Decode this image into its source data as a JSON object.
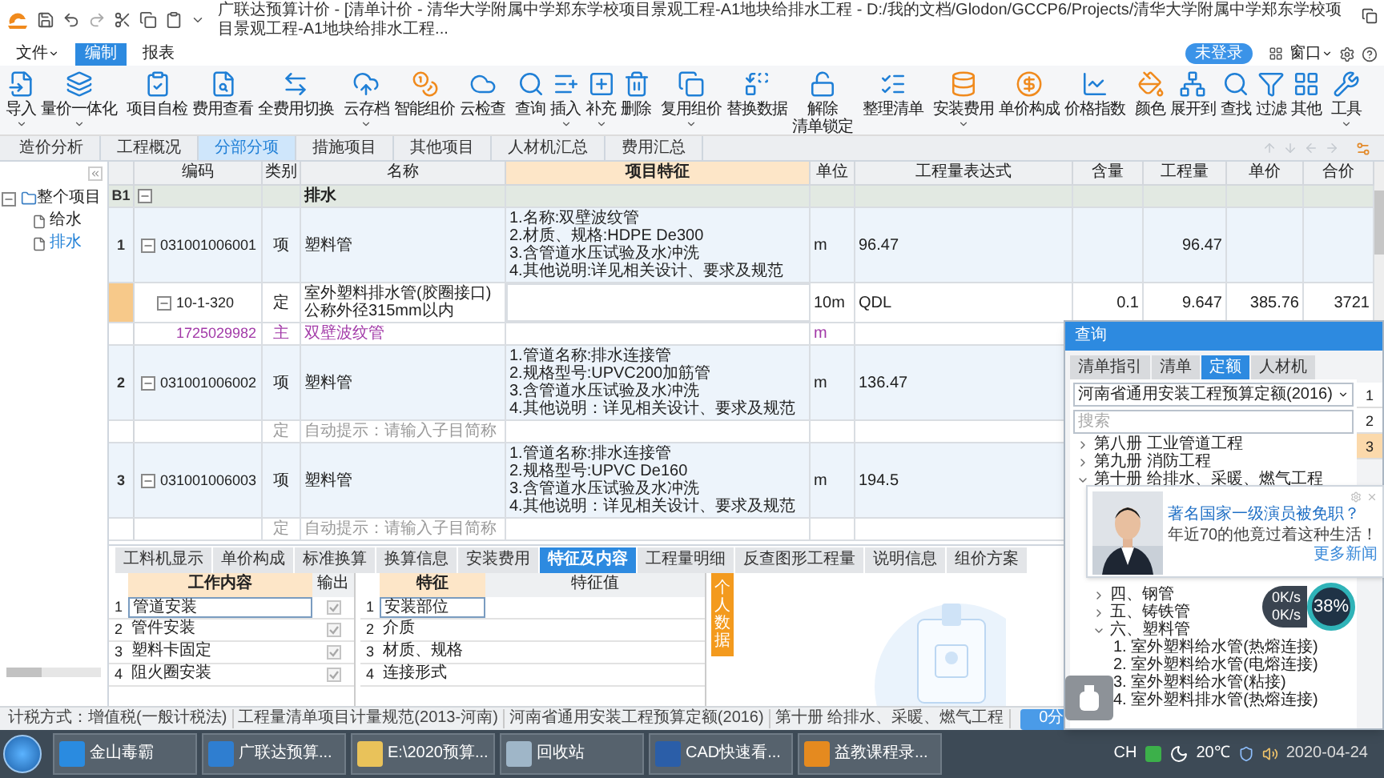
{
  "title_bar": {
    "title": "广联达预算计价 - [清单计价 - 清华大学附属中学郑东学校项目景观工程-A1地块给排水工程 - D:/我的文档/Glodon/GCCP6/Projects/清华大学附属中学郑东学校项目景观工程-A1地块给排水工程..."
  },
  "menu": {
    "items": [
      {
        "label": "文件",
        "dropdown": true,
        "selected": false
      },
      {
        "label": "编制",
        "dropdown": false,
        "selected": true
      },
      {
        "label": "报表",
        "dropdown": false,
        "selected": false
      }
    ],
    "login": "未登录",
    "window_menu": "窗口"
  },
  "toolbar": {
    "groups": [
      [
        {
          "label": "导入",
          "dropdown": true
        },
        {
          "label": "量价一体化",
          "dropdown": true
        }
      ],
      [
        {
          "label": "项目自检",
          "dropdown": false
        },
        {
          "label": "费用查看",
          "dropdown": false
        },
        {
          "label": "全费用切换",
          "dropdown": false
        }
      ],
      [
        {
          "label": "云存档",
          "dropdown": true
        },
        {
          "label": "智能组价",
          "dropdown": false
        },
        {
          "label": "云检查",
          "dropdown": false
        }
      ],
      [
        {
          "label": "查询",
          "dropdown": false
        },
        {
          "label": "插入",
          "dropdown": true
        },
        {
          "label": "补充",
          "dropdown": true
        },
        {
          "label": "删除",
          "dropdown": false
        }
      ],
      [
        {
          "label": "复用组价",
          "dropdown": true
        },
        {
          "label": "替换数据",
          "dropdown": false
        },
        {
          "label": "解除",
          "label_2": "清单锁定",
          "dropdown": false
        }
      ],
      [
        {
          "label": "整理清单",
          "dropdown": false
        }
      ],
      [
        {
          "label": "安装费用",
          "dropdown": true
        },
        {
          "label": "单价构成",
          "dropdown": false
        },
        {
          "label": "价格指数",
          "dropdown": false
        }
      ],
      [
        {
          "label": "颜色",
          "dropdown": false
        },
        {
          "label": "展开到",
          "dropdown": false
        },
        {
          "label": "查找",
          "dropdown": false
        },
        {
          "label": "过滤",
          "dropdown": false
        },
        {
          "label": "其他",
          "dropdown": false
        }
      ],
      [
        {
          "label": "工具",
          "dropdown": true
        }
      ]
    ]
  },
  "view_tabs": [
    {
      "label": "造价分析",
      "selected": false
    },
    {
      "label": "工程概况",
      "selected": false
    },
    {
      "label": "分部分项",
      "selected": true
    },
    {
      "label": "措施项目",
      "selected": false
    },
    {
      "label": "其他项目",
      "selected": false
    },
    {
      "label": "人材机汇总",
      "selected": false
    },
    {
      "label": "费用汇总",
      "selected": false
    }
  ],
  "project_tree": [
    {
      "label": "整个项目",
      "expanded": true,
      "selected": false,
      "children": [
        {
          "label": "给水",
          "selected": false
        },
        {
          "label": "排水",
          "selected": true
        }
      ]
    }
  ],
  "table": {
    "columns": [
      {
        "label": "编码",
        "selected": false
      },
      {
        "label": "类别",
        "selected": false
      },
      {
        "label": "名称",
        "selected": false
      },
      {
        "label": "项目特征",
        "selected": true
      },
      {
        "label": "单位",
        "selected": false
      },
      {
        "label": "工程量表达式",
        "selected": false
      },
      {
        "label": "含量",
        "selected": false
      },
      {
        "label": "工程量",
        "selected": false
      },
      {
        "label": "单价",
        "selected": false
      },
      {
        "label": "合价",
        "selected": false
      }
    ],
    "rows": [
      {
        "kind": "division",
        "number": "B1",
        "expanded": true,
        "selected": false,
        "name": "排水"
      },
      {
        "kind": "item",
        "number": "1",
        "code": "031001006001",
        "expanded": true,
        "selected": false,
        "category": "项",
        "name": "塑料管",
        "features": "1.名称:双壁波纹管\n2.材质、规格:HDPE De300\n3.含管道水压试验及水冲洗\n4.其他说明:详见相关设计、要求及规范",
        "unit": "m",
        "expression": "96.47",
        "quantity": "96.47"
      },
      {
        "kind": "quota",
        "code": "10-1-320",
        "expanded": true,
        "selected": true,
        "category": "定",
        "name": "室外塑料排水管(胶圈接口) 公称外径315mm以内",
        "unit": "10m",
        "expression": "QDL",
        "content": "0.1",
        "quantity": "9.647",
        "unit_price": "385.76",
        "total": "3721"
      },
      {
        "kind": "material",
        "code": "1725029982",
        "selected": false,
        "category": "主",
        "name": "双壁波纹管",
        "unit": "m"
      },
      {
        "kind": "item",
        "number": "2",
        "code": "031001006002",
        "expanded": true,
        "selected": false,
        "category": "项",
        "name": "塑料管",
        "features": "1.管道名称:排水连接管\n2.规格型号:UPVC200加筋管\n3.含管道水压试验及水冲洗\n4.其他说明：详见相关设计、要求及规范",
        "unit": "m",
        "expression": "136.47"
      },
      {
        "kind": "hint",
        "selected": false,
        "category": "定",
        "name": "自动提示：请输入子目简称"
      },
      {
        "kind": "item",
        "number": "3",
        "code": "031001006003",
        "expanded": true,
        "selected": false,
        "category": "项",
        "name": "塑料管",
        "features": "1.管道名称:排水连接管\n2.规格型号:UPVC De160\n3.含管道水压试验及水冲洗\n4.其他说明：详见相关设计、要求及规范",
        "unit": "m",
        "expression": "194.5"
      },
      {
        "kind": "hint",
        "selected": false,
        "category": "定",
        "name": "自动提示：请输入子目简称"
      }
    ]
  },
  "detail_tabs": [
    {
      "label": "工料机显示",
      "selected": false
    },
    {
      "label": "单价构成",
      "selected": false
    },
    {
      "label": "标准换算",
      "selected": false
    },
    {
      "label": "换算信息",
      "selected": false
    },
    {
      "label": "安装费用",
      "selected": false
    },
    {
      "label": "特征及内容",
      "selected": true
    },
    {
      "label": "工程量明细",
      "selected": false
    },
    {
      "label": "反查图形工程量",
      "selected": false
    },
    {
      "label": "说明信息",
      "selected": false
    },
    {
      "label": "组价方案",
      "selected": false
    }
  ],
  "work_content": {
    "columns": [
      "工作内容",
      "输出"
    ],
    "rows": [
      {
        "number": "1",
        "content": "管道安装",
        "output": true,
        "selected": true
      },
      {
        "number": "2",
        "content": "管件安装",
        "output": true,
        "selected": false
      },
      {
        "number": "3",
        "content": "塑料卡固定",
        "output": true,
        "selected": false
      },
      {
        "number": "4",
        "content": "阻火圈安装",
        "output": true,
        "selected": false
      }
    ]
  },
  "features_table": {
    "columns": [
      "特征",
      "特征值"
    ],
    "rows": [
      {
        "number": "1",
        "feature": "安装部位",
        "selected": true
      },
      {
        "number": "2",
        "feature": "介质",
        "selected": false
      },
      {
        "number": "3",
        "feature": "材质、规格",
        "selected": false
      },
      {
        "number": "4",
        "feature": "连接形式",
        "selected": false
      }
    ]
  },
  "side_tab": "个人数据",
  "status_bar": {
    "items": [
      "计税方式：增值税(一般计税法)",
      "工程量清单项目计量规范(2013-河南)",
      "河南省通用安装工程预算定额(2016)",
      "第十册 给排水、采暖、燃气工程"
    ],
    "score_button": "0分"
  },
  "query_dialog": {
    "title": "查询",
    "tabs": [
      {
        "label": "清单指引",
        "selected": false
      },
      {
        "label": "清单",
        "selected": false
      },
      {
        "label": "定额",
        "selected": true
      },
      {
        "label": "人材机",
        "selected": false
      }
    ],
    "library": "河南省通用安装工程预算定额(2016)",
    "search": {
      "placeholder": "搜索"
    },
    "tree": [
      {
        "label": "第八册 工业管道工程",
        "expanded": false
      },
      {
        "label": "第九册 消防工程",
        "expanded": false
      },
      {
        "label": "第十册 给排水、采暖、燃气工程",
        "expanded": true,
        "children": [
          {
            "label": "四、钢管",
            "expanded": false
          },
          {
            "label": "五、铸铁管",
            "expanded": false
          },
          {
            "label": "六、塑料管",
            "expanded": true,
            "children": [
              {
                "label": "1. 室外塑料给水管(热熔连接)"
              },
              {
                "label": "2. 室外塑料给水管(电熔连接)"
              },
              {
                "label": "3. 室外塑料给水管(粘接)"
              },
              {
                "label": "4. 室外塑料排水管(热熔连接)"
              }
            ]
          }
        ]
      }
    ],
    "side_list": [
      {
        "label": "1",
        "selected": false
      },
      {
        "label": "2",
        "selected": false
      },
      {
        "label": "3",
        "selected": true
      }
    ]
  },
  "news_popup": {
    "headline": "著名国家一级演员被免职？",
    "summary": "年近70的他竟过着这种生活！",
    "link": "更多新闻"
  },
  "speed_widget": {
    "upload": "0K/s",
    "download": "0K/s",
    "load": "38%"
  },
  "taskbar": {
    "items": [
      "金山毒霸",
      "广联达预算...",
      "E:\\2020预算...",
      "回收站",
      "CAD快速看...",
      "益教课程录..."
    ],
    "language": "CH",
    "temperature": "20℃",
    "date": "2020-04-24"
  }
}
